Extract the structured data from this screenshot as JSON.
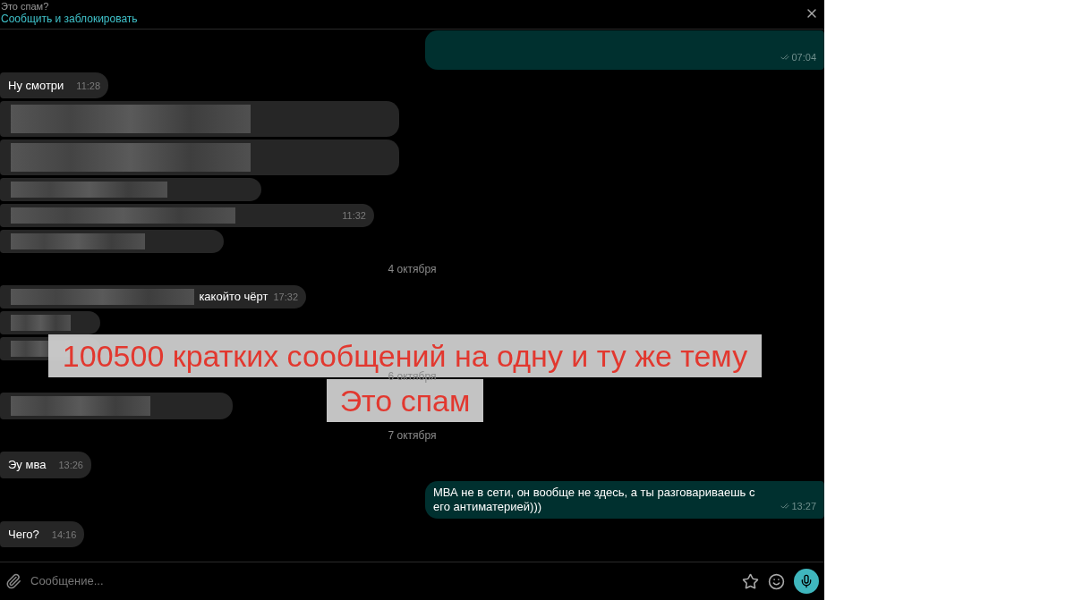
{
  "spam_banner": {
    "question": "Это спам?",
    "action": "Сообщить и заблокировать"
  },
  "messages": [
    {
      "kind": "outgoing",
      "time": "07:04"
    },
    {
      "kind": "incoming",
      "text": "Ну смотри",
      "time": "11:28"
    },
    {
      "kind": "redacted"
    },
    {
      "kind": "redacted"
    },
    {
      "kind": "redacted"
    },
    {
      "kind": "redacted",
      "time": "11:32"
    },
    {
      "kind": "redacted"
    },
    {
      "kind": "date",
      "text": "4 октября"
    },
    {
      "kind": "redacted",
      "text": "какойто чёрт",
      "time": "17:32"
    },
    {
      "kind": "redacted"
    },
    {
      "kind": "redacted"
    },
    {
      "kind": "date",
      "text": "6 октября"
    },
    {
      "kind": "redacted"
    },
    {
      "kind": "date",
      "text": "7 октября"
    },
    {
      "kind": "incoming",
      "text": "Эу мва",
      "time": "13:26"
    },
    {
      "kind": "outgoing",
      "text": "МВА не в сети, он вообще не здесь, а ты разговариваешь с его антиматерией)))",
      "time": "13:27"
    },
    {
      "kind": "incoming",
      "text": "Чего?",
      "time": "14:16"
    }
  ],
  "composer": {
    "placeholder": "Сообщение..."
  },
  "overlay_captions": [
    "100500 кратких сообщений на одну и ту же тему",
    "Это спам"
  ]
}
